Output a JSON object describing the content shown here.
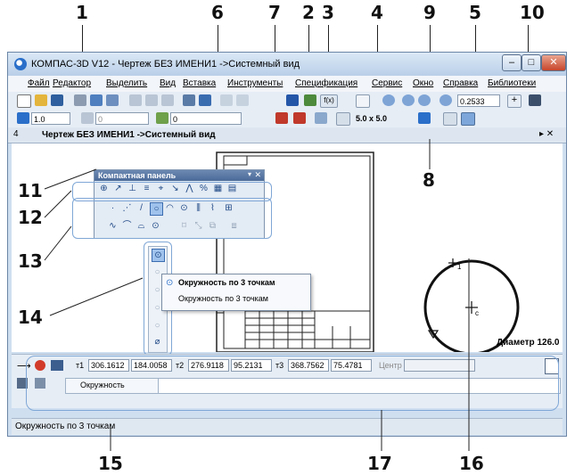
{
  "callouts": [
    "1",
    "6",
    "7",
    "2",
    "3",
    "4",
    "9",
    "5",
    "10",
    "8",
    "11",
    "12",
    "13",
    "14",
    "15",
    "17",
    "16"
  ],
  "window": {
    "title": "КОМПАС-3D V12 - Чертеж БЕЗ ИМЕНИ1 ->Системный вид",
    "controls": {
      "minimize": "–",
      "maximize": "□",
      "close": "✕"
    }
  },
  "menu": [
    "Файл",
    "Редактор",
    "Выделить",
    "Вид",
    "Вставка",
    "Инструменты",
    "Спецификация",
    "Сервис",
    "Окно",
    "Справка",
    "Библиотеки"
  ],
  "toolbar1": {
    "zoom_value": "0.2533"
  },
  "toolbar2": {
    "layer_value": "1.0",
    "field2": "0",
    "field3": "0",
    "grid_value": "5.0 x 5.0"
  },
  "doc_tab": {
    "label": "Чертеж БЕЗ ИМЕНИ1 ->Системный вид",
    "pin_icon": "4",
    "nav": "▸ ✕"
  },
  "compact_panel": {
    "title": "Компактная панель"
  },
  "tooltip": {
    "title": "Окружность по 3 точкам",
    "subtitle": "Окружность по 3 точкам"
  },
  "circle": {
    "point_label": "1",
    "center_label": "c",
    "dimension_label": "Диаметр 126.0"
  },
  "props": {
    "p1_label": "т1",
    "p1_x": "306.1612",
    "p1_y": "184.0058",
    "p2_label": "т2",
    "p2_x": "276.9118",
    "p2_y": "95.2131",
    "p3_label": "т3",
    "p3_x": "368.7562",
    "p3_y": "75.4781",
    "center_label": "Центр",
    "object_tab": "Окружность"
  },
  "status": {
    "text": "Окружность по 3 точкам"
  },
  "colors": {
    "accent": "#2a6fc9",
    "window_bg": "#cfdff0",
    "close": "#c7452a"
  }
}
